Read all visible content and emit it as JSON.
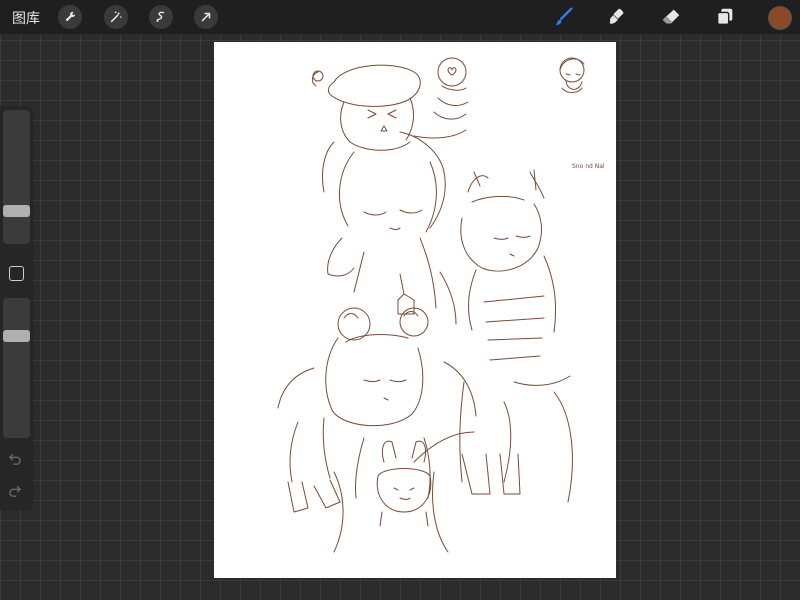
{
  "topbar": {
    "gallery_label": "图库",
    "tools_left": [
      "wrench-icon",
      "magic-wand-icon",
      "selection-icon",
      "transform-arrow-icon"
    ],
    "tools_right": [
      "brush-icon",
      "smudge-icon",
      "eraser-icon",
      "layers-icon"
    ],
    "active_tool": "brush",
    "active_color": "#8a4a2a",
    "accent_color": "#2f7bf5"
  },
  "sidebar": {
    "brush_size_level": 0.22,
    "opacity_level": 0.75,
    "undo_icon": "undo-icon",
    "redo_icon": "redo-icon"
  },
  "canvas": {
    "background": "#ffffff",
    "stroke_color": "#7a4a36",
    "sketch_annotation": "Sno nd Nal"
  }
}
